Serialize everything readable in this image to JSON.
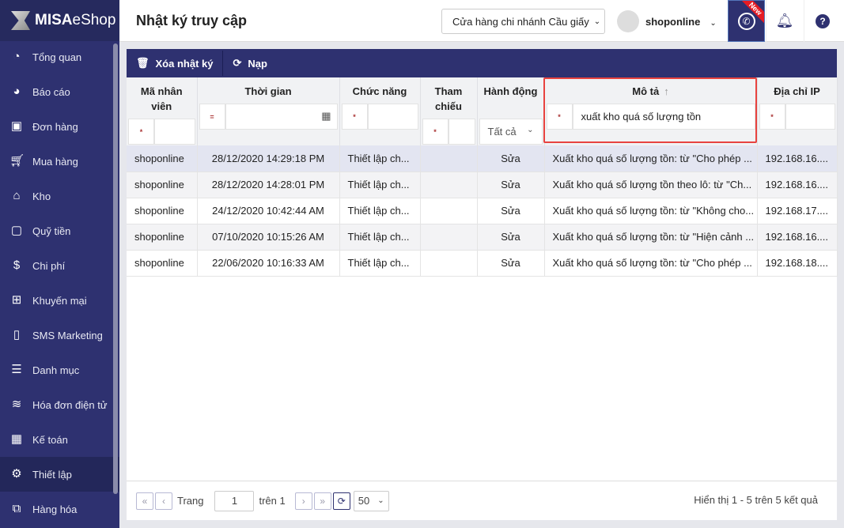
{
  "brand": {
    "name_bold": "MISA",
    "name_light": "eShop"
  },
  "sidebar": {
    "items": [
      {
        "label": "Tổng quan",
        "icon": "gauge-icon"
      },
      {
        "label": "Báo cáo",
        "icon": "pie-chart-icon"
      },
      {
        "label": "Đơn hàng",
        "icon": "order-icon"
      },
      {
        "label": "Mua hàng",
        "icon": "cart-icon"
      },
      {
        "label": "Kho",
        "icon": "warehouse-icon"
      },
      {
        "label": "Quỹ tiền",
        "icon": "safe-icon"
      },
      {
        "label": "Chi phí",
        "icon": "money-bag-icon"
      },
      {
        "label": "Khuyến mại",
        "icon": "gift-icon"
      },
      {
        "label": "SMS Marketing",
        "icon": "phone-icon"
      },
      {
        "label": "Danh mục",
        "icon": "list-icon"
      },
      {
        "label": "Hóa đơn điện tử",
        "icon": "invoice-icon"
      },
      {
        "label": "Kế toán",
        "icon": "calculator-icon"
      },
      {
        "label": "Thiết lập",
        "icon": "gear-icon",
        "active": true
      },
      {
        "label": "Hàng hóa",
        "icon": "boxes-icon"
      }
    ]
  },
  "header": {
    "title": "Nhật ký truy cập",
    "branch": "Cửa hàng chi nhánh Cầu giấy",
    "user": "shoponline",
    "new_badge": "New"
  },
  "toolbar": {
    "delete": "Xóa nhật ký",
    "reload": "Nạp"
  },
  "table": {
    "columns": [
      {
        "label": "Mã nhân viên",
        "op": "*",
        "filter": ""
      },
      {
        "label": "Thời gian",
        "op": "=",
        "filter": ""
      },
      {
        "label": "Chức năng",
        "op": "*",
        "filter": ""
      },
      {
        "label": "Tham chiếu",
        "op": "*",
        "filter": ""
      },
      {
        "label": "Hành động",
        "filter": "Tất cả"
      },
      {
        "label": "Mô tả",
        "op": "*",
        "filter": "xuất kho quá số lượng tồn",
        "sort": "ascending"
      },
      {
        "label": "Địa chỉ IP",
        "op": "*",
        "filter": ""
      }
    ],
    "rows": [
      [
        "shoponline",
        "28/12/2020 14:29:18 PM",
        "Thiết lập ch...",
        "",
        "Sửa",
        "Xuất kho quá số lượng tồn: từ \"Cho phép ...",
        "192.168.16...."
      ],
      [
        "shoponline",
        "28/12/2020 14:28:01 PM",
        "Thiết lập ch...",
        "",
        "Sửa",
        "Xuất kho quá số lượng tồn theo lô: từ \"Ch...",
        "192.168.16...."
      ],
      [
        "shoponline",
        "24/12/2020 10:42:44 AM",
        "Thiết lập ch...",
        "",
        "Sửa",
        "Xuất kho quá số lượng tồn: từ \"Không cho...",
        "192.168.17...."
      ],
      [
        "shoponline",
        "07/10/2020 10:15:26 AM",
        "Thiết lập ch...",
        "",
        "Sửa",
        "Xuất kho quá số lượng tồn: từ \"Hiện cảnh ...",
        "192.168.16...."
      ],
      [
        "shoponline",
        "22/06/2020 10:16:33 AM",
        "Thiết lập ch...",
        "",
        "Sửa",
        "Xuất kho quá số lượng tồn: từ \"Cho phép ...",
        "192.168.18...."
      ]
    ]
  },
  "pager": {
    "page_label": "Trang",
    "page": "1",
    "of_label": "trên 1",
    "page_size": "50",
    "summary": "Hiển thị 1 - 5 trên 5 kết quả"
  }
}
